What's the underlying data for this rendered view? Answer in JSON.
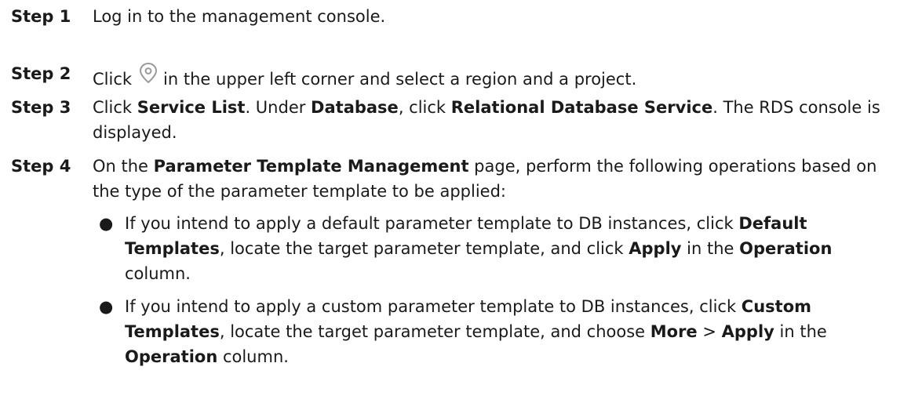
{
  "steps": [
    {
      "label": "Step 1",
      "text": "Log in to the management console."
    },
    {
      "label": "Step 2",
      "text_before_icon": "Click",
      "icon": "location-pin-icon",
      "text_after_icon": "in the upper left corner and select a region and a project."
    },
    {
      "label": "Step 3",
      "p1": "Click ",
      "b1": "Service List",
      "p2": ". Under ",
      "b2": "Database",
      "p3": ", click ",
      "b3": "Relational Database Service",
      "p4": ". The RDS console is displayed."
    },
    {
      "label": "Step 4",
      "p1": "On the ",
      "b1": "Parameter Template Management",
      "p2": " page, perform the following operations based on the type of the parameter template to be applied:"
    }
  ],
  "bullets": [
    {
      "p1": "If you intend to apply a default parameter template to DB instances, click ",
      "b1": "Default Templates",
      "p2": ", locate the target parameter template, and click ",
      "b2": "Apply",
      "p3": " in the ",
      "b3": "Operation",
      "p4": " column."
    },
    {
      "p1": "If you intend to apply a custom parameter template to DB instances, click ",
      "b1": "Custom Templates",
      "p2": ", locate the target parameter template, and choose ",
      "b2": "More",
      "p3": " > ",
      "b3": "Apply",
      "p4": " in the ",
      "b4": "Operation",
      "p5": " column."
    }
  ],
  "bullet_glyph": "●",
  "colors": {
    "text": "#1a1a1a",
    "icon": "#9a9a9a"
  }
}
